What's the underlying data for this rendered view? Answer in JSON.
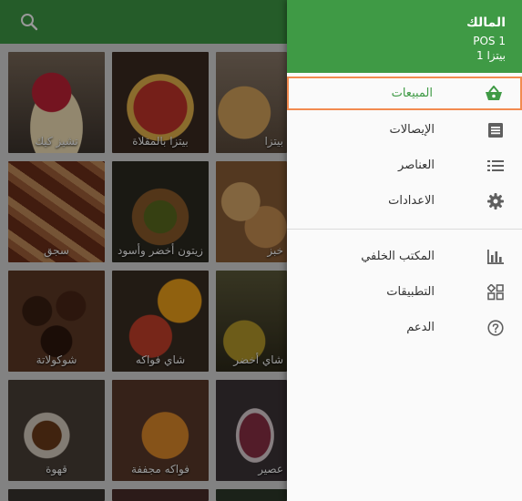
{
  "app_bar": {
    "search_icon": "search-icon"
  },
  "products": [
    {
      "name": "تشيز كيك"
    },
    {
      "name": "بيتزا بالمقلاة"
    },
    {
      "name": "بيتزا"
    },
    {
      "name": "سجق"
    },
    {
      "name": "زيتون أخضر وأسود"
    },
    {
      "name": "خبز"
    },
    {
      "name": "شوكولاتة"
    },
    {
      "name": "شاي فواكه"
    },
    {
      "name": "شاي أخضر"
    },
    {
      "name": "قهوة"
    },
    {
      "name": "فواكه مجففة"
    },
    {
      "name": "عصير"
    }
  ],
  "drawer": {
    "owner": "المالك",
    "pos": "POS 1",
    "store": "بيتزا 1",
    "items": [
      {
        "label": "المبيعات",
        "icon": "basket-icon"
      },
      {
        "label": "الإيصالات",
        "icon": "receipt-icon"
      },
      {
        "label": "العناصر",
        "icon": "list-icon"
      },
      {
        "label": "الاعدادات",
        "icon": "gear-icon"
      }
    ],
    "secondary_items": [
      {
        "label": "المكتب الخلفي",
        "icon": "bar-chart-icon"
      },
      {
        "label": "التطبيقات",
        "icon": "apps-icon"
      },
      {
        "label": "الدعم",
        "icon": "help-icon"
      }
    ]
  },
  "colors": {
    "primary": "#3f9a45",
    "selected_border": "#f28b50",
    "icon": "#5f5f5f"
  }
}
